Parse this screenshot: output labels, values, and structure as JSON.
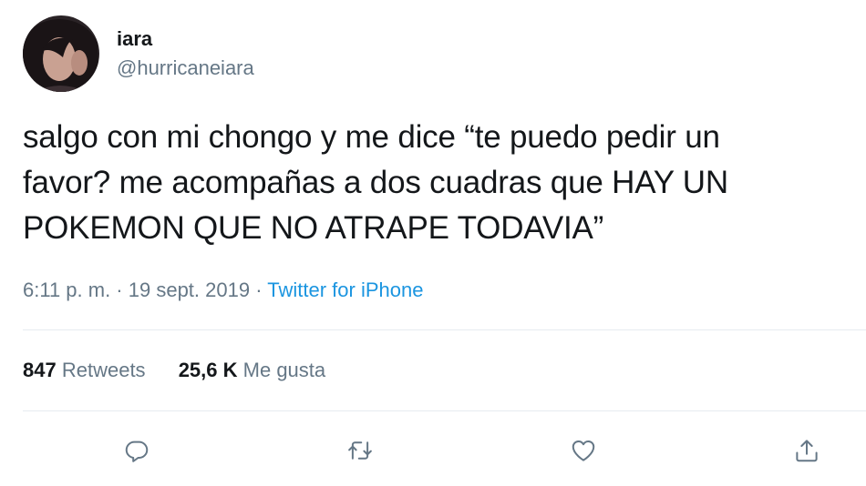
{
  "user": {
    "display_name": "iara",
    "handle": "@hurricaneiara",
    "avatar_icon": "user-avatar-photo"
  },
  "tweet": {
    "lines": [
      "salgo con mi chongo y me dice “te puedo pedir un",
      "favor? me acompañas a dos cuadras que HAY UN",
      "POKEMON QUE NO ATRAPE TODAVIA”"
    ]
  },
  "meta": {
    "timestamp": "6:11 p. m. · 19 sept. 2019",
    "separator": "·",
    "source": "Twitter for iPhone"
  },
  "stats": {
    "retweets_count": "847",
    "retweets_label": "Retweets",
    "likes_count": "25,6 K",
    "likes_label": "Me gusta"
  },
  "actions": {
    "reply_icon": "reply-icon",
    "retweet_icon": "retweet-icon",
    "like_icon": "heart-icon",
    "share_icon": "share-icon"
  },
  "colors": {
    "text": "#14171a",
    "secondary": "#657786",
    "link": "#1b95e0",
    "divider": "#e6ecf0"
  }
}
